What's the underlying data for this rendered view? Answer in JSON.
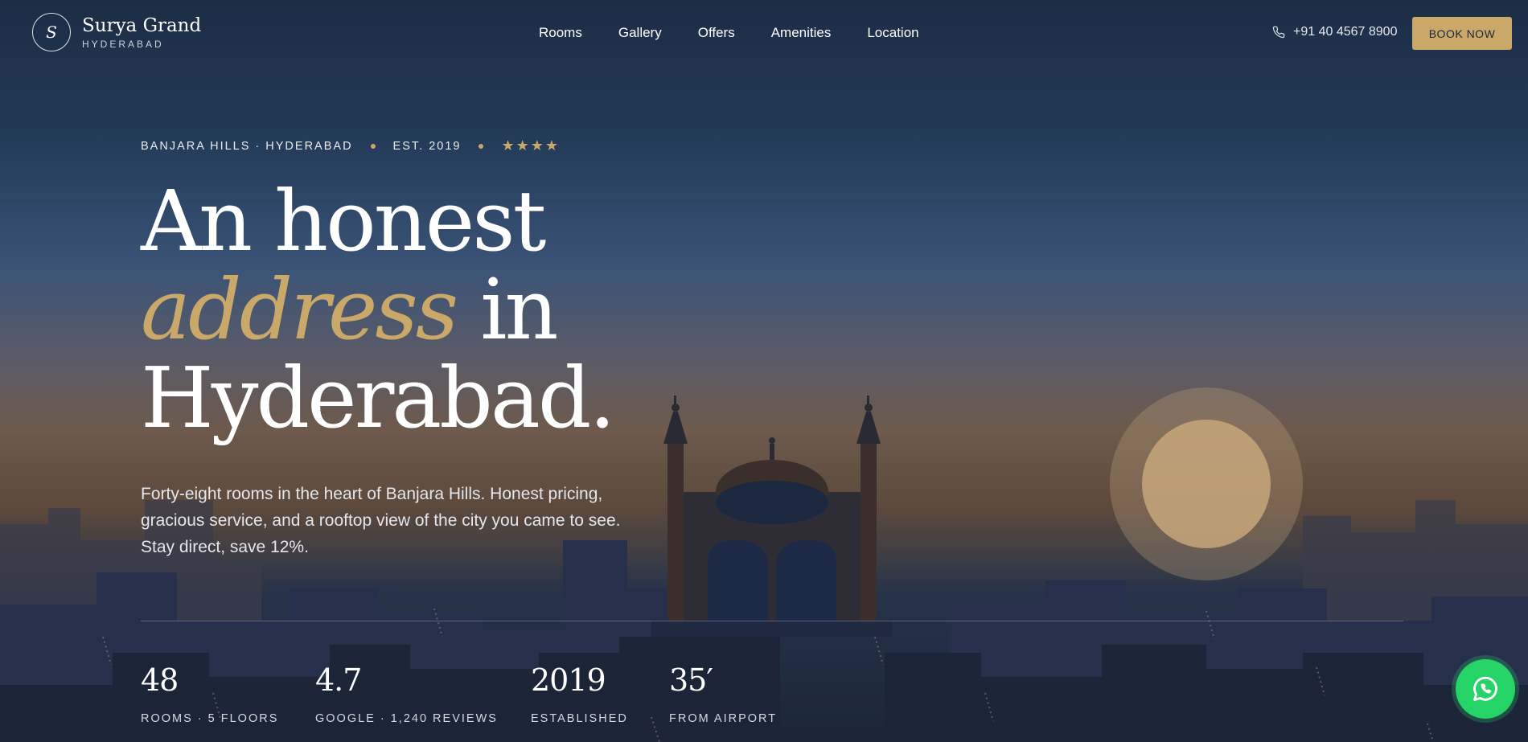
{
  "brand": {
    "initial": "S",
    "name": "Surya Grand",
    "city": "HYDERABAD"
  },
  "nav": [
    "Rooms",
    "Gallery",
    "Offers",
    "Amenities",
    "Location"
  ],
  "contact": {
    "phone": "+91 40 4567 8900",
    "phone_icon": "phone-icon"
  },
  "cta": {
    "book_label": "BOOK NOW"
  },
  "hero": {
    "location": "BANJARA HILLS · HYDERABAD",
    "established": "EST. 2019",
    "stars": "★★★★",
    "star_rating": 4,
    "headline_1": "An honest",
    "headline_accent": "address",
    "headline_2": "in",
    "headline_3": "Hyderabad.",
    "description": "Forty-eight rooms in the heart of Banjara Hills. Honest pricing, gracious service, and a rooftop view of the city you came to see. Stay direct, save 12%."
  },
  "stats": [
    {
      "value": "48",
      "label": "ROOMS · 5 FLOORS"
    },
    {
      "value": "4.7",
      "label": "GOOGLE · 1,240 REVIEWS"
    },
    {
      "value": "2019",
      "label": "ESTABLISHED"
    },
    {
      "value": "35′",
      "label": "FROM AIRPORT"
    }
  ],
  "floating": {
    "whatsapp_icon": "whatsapp-icon"
  },
  "colors": {
    "accent": "#c9a86a",
    "whatsapp": "#25d366",
    "night": "#1c2d45"
  }
}
